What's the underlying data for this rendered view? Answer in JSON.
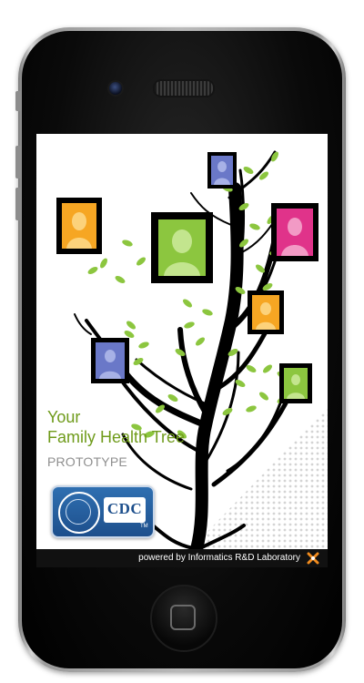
{
  "app": {
    "title_line1": "Your",
    "title_line2": "Family Health Tree",
    "subtitle": "PROTOTYPE",
    "footer": "powered by Informatics R&D Laboratory"
  },
  "badge": {
    "agency": "CDC",
    "tm": "TM"
  },
  "colors": {
    "title": "#6f9b1b",
    "subtitle": "#8f8f8f",
    "leaf": "#8cc63f",
    "frame": "#000000",
    "portrait_orange": "#f6a623",
    "portrait_green": "#8cc63f",
    "portrait_magenta": "#e0338a",
    "portrait_blue": "#6a78c8",
    "footer_bg": "#111111"
  },
  "icons": [
    "phone-camera-icon",
    "speaker-grille-icon",
    "home-button-icon",
    "hhs-seal-icon",
    "lab-logo-icon"
  ]
}
